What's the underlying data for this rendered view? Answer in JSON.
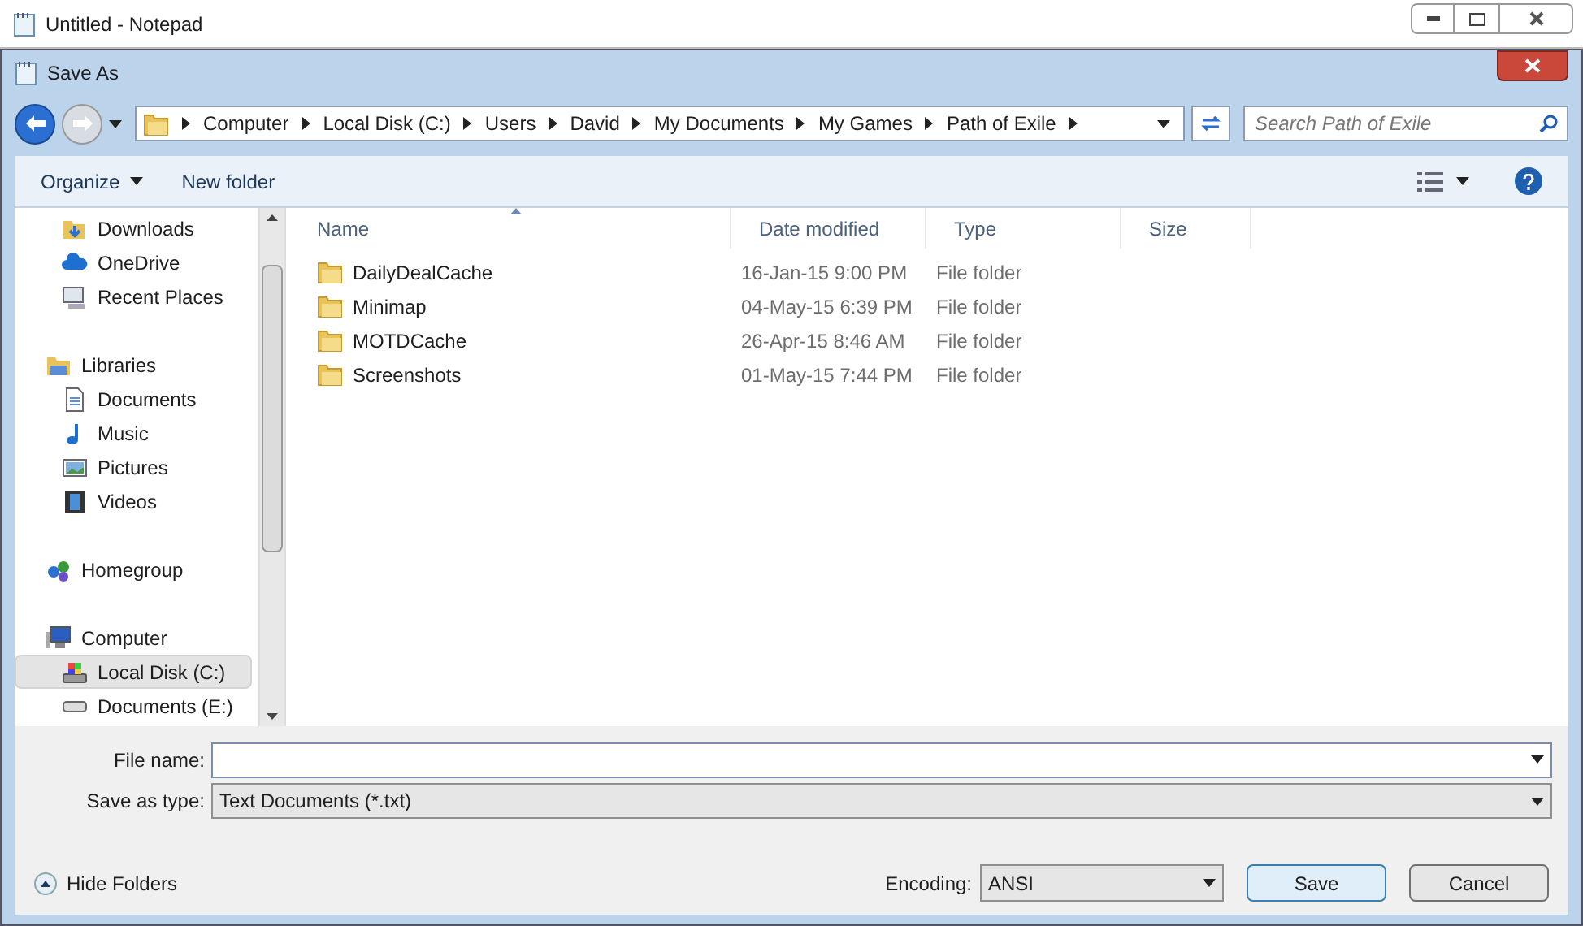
{
  "app_window": {
    "title": "Untitled - Notepad"
  },
  "dialog": {
    "title": "Save As"
  },
  "address_bar": {
    "crumbs": [
      "Computer",
      "Local Disk (C:)",
      "Users",
      "David",
      "My Documents",
      "My Games",
      "Path of Exile"
    ]
  },
  "search": {
    "placeholder": "Search Path of Exile"
  },
  "toolbar": {
    "organize": "Organize",
    "new_folder": "New folder"
  },
  "sidebar": [
    {
      "children": [
        {
          "label": "Downloads",
          "kind": "downloads",
          "selected": false
        },
        {
          "label": "OneDrive",
          "kind": "cloud",
          "selected": false
        },
        {
          "label": "Recent Places",
          "kind": "recent",
          "selected": false
        }
      ]
    },
    {
      "label": "Libraries",
      "kind": "library",
      "selected": false,
      "children": [
        {
          "label": "Documents",
          "kind": "document",
          "selected": false
        },
        {
          "label": "Music",
          "kind": "music",
          "selected": false
        },
        {
          "label": "Pictures",
          "kind": "pictures",
          "selected": false
        },
        {
          "label": "Videos",
          "kind": "videos",
          "selected": false
        }
      ]
    },
    {
      "label": "Homegroup",
      "kind": "homegroup",
      "selected": false
    },
    {
      "label": "Computer",
      "kind": "computer",
      "selected": false,
      "children": [
        {
          "label": "Local Disk (C:)",
          "kind": "disk",
          "selected": true
        },
        {
          "label": "Documents  (E:)",
          "kind": "drive",
          "selected": false
        }
      ]
    }
  ],
  "table": {
    "columns": [
      "Name",
      "Date modified",
      "Type",
      "Size"
    ],
    "rows": [
      {
        "name": "DailyDealCache",
        "date": "16-Jan-15 9:00 PM",
        "type": "File folder"
      },
      {
        "name": "Minimap",
        "date": "04-May-15 6:39 PM",
        "type": "File folder"
      },
      {
        "name": "MOTDCache",
        "date": "26-Apr-15 8:46 AM",
        "type": "File folder"
      },
      {
        "name": "Screenshots",
        "date": "01-May-15 7:44 PM",
        "type": "File folder"
      }
    ]
  },
  "form": {
    "file_name_label": "File name:",
    "save_type_label": "Save as type:",
    "save_type_value": "Text Documents (*.txt)"
  },
  "footer": {
    "hide_folders": "Hide Folders",
    "encoding_label": "Encoding:",
    "encoding_value": "ANSI",
    "save": "Save",
    "cancel": "Cancel"
  }
}
